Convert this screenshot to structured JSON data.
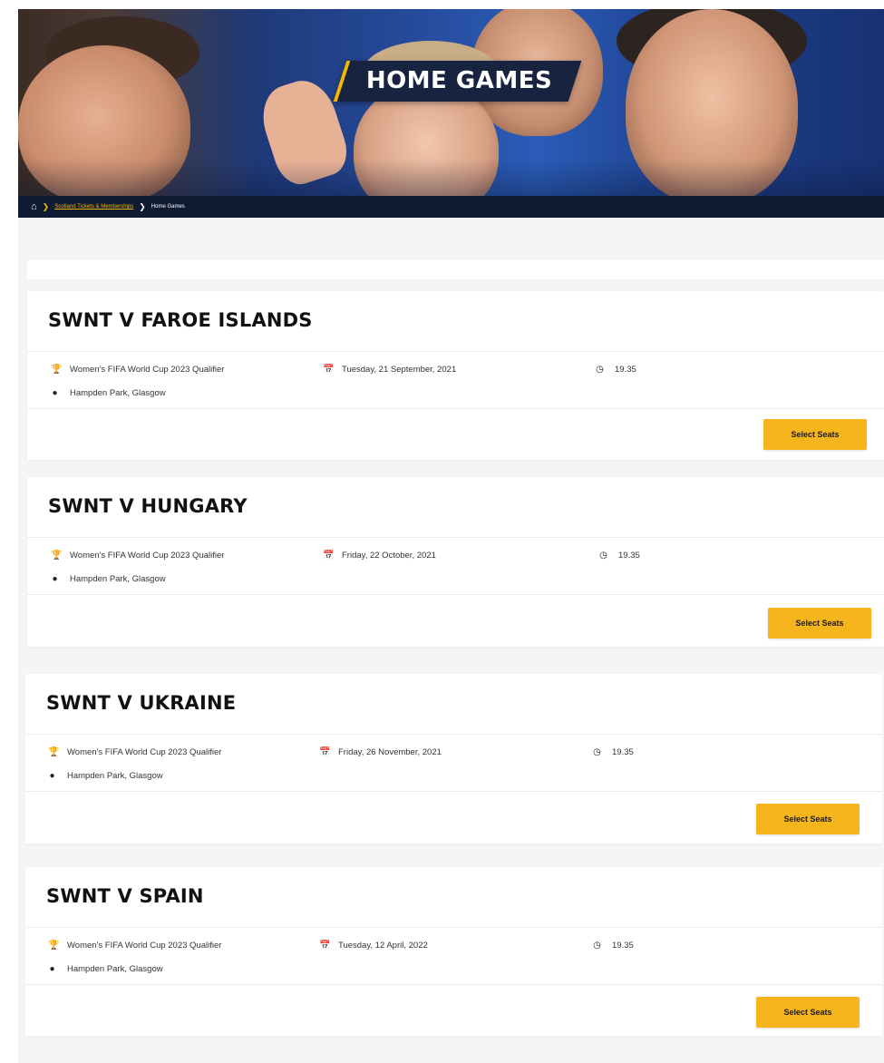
{
  "hero": {
    "title": "HOME GAMES"
  },
  "breadcrumb": {
    "home_icon": "home-icon",
    "separator_icon": "chevron-right-icon",
    "link": "Scotland Tickets & Memberships",
    "current": "Home Games"
  },
  "matches": [
    {
      "title": "SWNT V FAROE ISLANDS",
      "competition": "Women's FIFA World Cup 2023 Qualifier",
      "date": "Tuesday, 21 September, 2021",
      "time": "19.35",
      "venue": "Hampden Park, Glasgow",
      "button": "Select Seats"
    },
    {
      "title": "SWNT V HUNGARY",
      "competition": "Women's FIFA World Cup 2023 Qualifier",
      "date": "Friday, 22 October, 2021",
      "time": "19.35",
      "venue": "Hampden Park, Glasgow",
      "button": "Select Seats"
    },
    {
      "title": "SWNT V UKRAINE",
      "competition": "Women's FIFA World Cup 2023 Qualifier",
      "date": "Friday, 26 November, 2021",
      "time": "19.35",
      "venue": "Hampden Park, Glasgow",
      "button": "Select Seats"
    },
    {
      "title": "SWNT V SPAIN",
      "competition": "Women's FIFA World Cup 2023 Qualifier",
      "date": "Tuesday, 12 April, 2022",
      "time": "19.35",
      "venue": "Hampden Park, Glasgow",
      "button": "Select Seats"
    }
  ],
  "icons": {
    "competition": "trophy-icon",
    "date": "calendar-icon",
    "time": "clock-icon",
    "venue": "map-pin-icon"
  },
  "colors": {
    "accent": "#f7b51d",
    "navy": "#0f1a33",
    "title_badge": "#18243f"
  }
}
